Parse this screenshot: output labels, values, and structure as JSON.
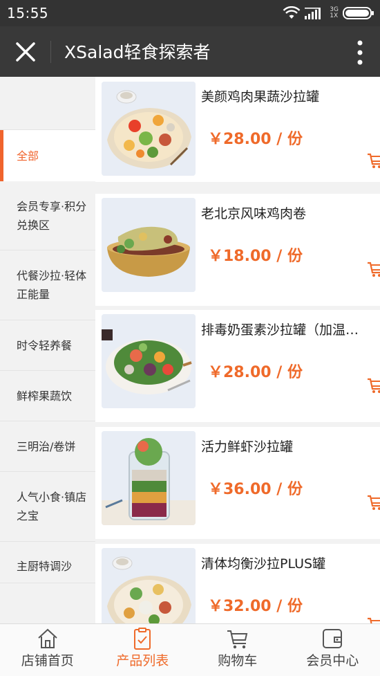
{
  "status_bar": {
    "time": "15:55",
    "network": [
      "3G",
      "1X"
    ]
  },
  "header": {
    "title": "XSalad轻食探索者"
  },
  "colors": {
    "accent": "#ef6a2a",
    "titlebar": "#393939",
    "statusbar": "#333333"
  },
  "categories": [
    {
      "label": "",
      "active": false
    },
    {
      "label": "全部",
      "active": true
    },
    {
      "label": "会员专享·积分兑换区",
      "active": false
    },
    {
      "label": "代餐沙拉·轻体正能量",
      "active": false
    },
    {
      "label": "时令轻养餐",
      "active": false
    },
    {
      "label": "鲜榨果蔬饮",
      "active": false
    },
    {
      "label": "三明治/卷饼",
      "active": false
    },
    {
      "label": "人气小食·镇店之宝",
      "active": false
    },
    {
      "label": "主厨特调沙",
      "active": false
    }
  ],
  "products": [
    {
      "name": "美颜鸡肉果蔬沙拉罐",
      "price": "￥28.00 / 份",
      "image": "salad-bowl-image",
      "cart_icon": "cart-icon"
    },
    {
      "name": "老北京风味鸡肉卷",
      "price": "￥18.00 / 份",
      "image": "chicken-wrap-image",
      "cart_icon": "cart-icon"
    },
    {
      "name": "排毒奶蛋素沙拉罐（加温…",
      "price": "￥28.00 / 份",
      "image": "salad-plate-image",
      "cart_icon": "cart-icon"
    },
    {
      "name": "活力鲜虾沙拉罐",
      "price": "￥36.00 / 份",
      "image": "salad-jar-image",
      "cart_icon": "cart-icon"
    },
    {
      "name": "清体均衡沙拉PLUS罐",
      "price": "￥32.00 / 份",
      "image": "salad-bowl-image",
      "cart_icon": "cart-icon"
    }
  ],
  "tabbar": {
    "items": [
      {
        "label": "店铺首页",
        "icon": "home-icon",
        "active": false
      },
      {
        "label": "产品列表",
        "icon": "list-icon",
        "active": true
      },
      {
        "label": "购物车",
        "icon": "cart-icon",
        "active": false
      },
      {
        "label": "会员中心",
        "icon": "wallet-icon",
        "active": false
      }
    ]
  }
}
